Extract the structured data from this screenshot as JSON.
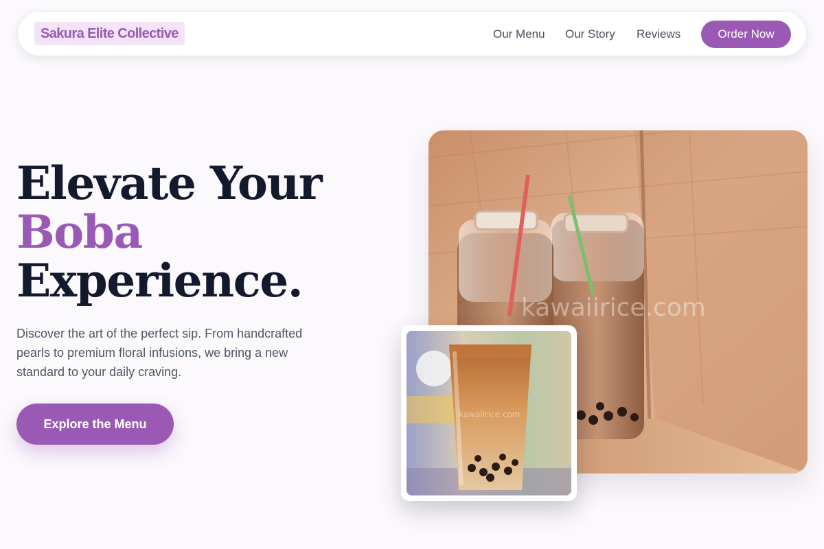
{
  "nav": {
    "brand": "Sakura Elite Collective",
    "links": [
      "Our Menu",
      "Our Story",
      "Reviews"
    ],
    "cta": "Order Now"
  },
  "hero": {
    "headline_line1": "Elevate Your",
    "headline_accent": "Boba",
    "headline_line3": "Experience.",
    "subtext": "Discover the art of the perfect sip. From handcrafted pearls to premium floral infusions, we bring a new standard to your daily craving.",
    "cta": "Explore the Menu"
  },
  "images": {
    "main_watermark": "kawaiirice.com",
    "inset_watermark": "kawaiirice.com"
  },
  "colors": {
    "accent": "#9b59b6",
    "brand_bg": "#f3e5f7",
    "heading": "#141a2e",
    "body_text": "#4f5565",
    "page_bg": "#fbf9fc"
  }
}
